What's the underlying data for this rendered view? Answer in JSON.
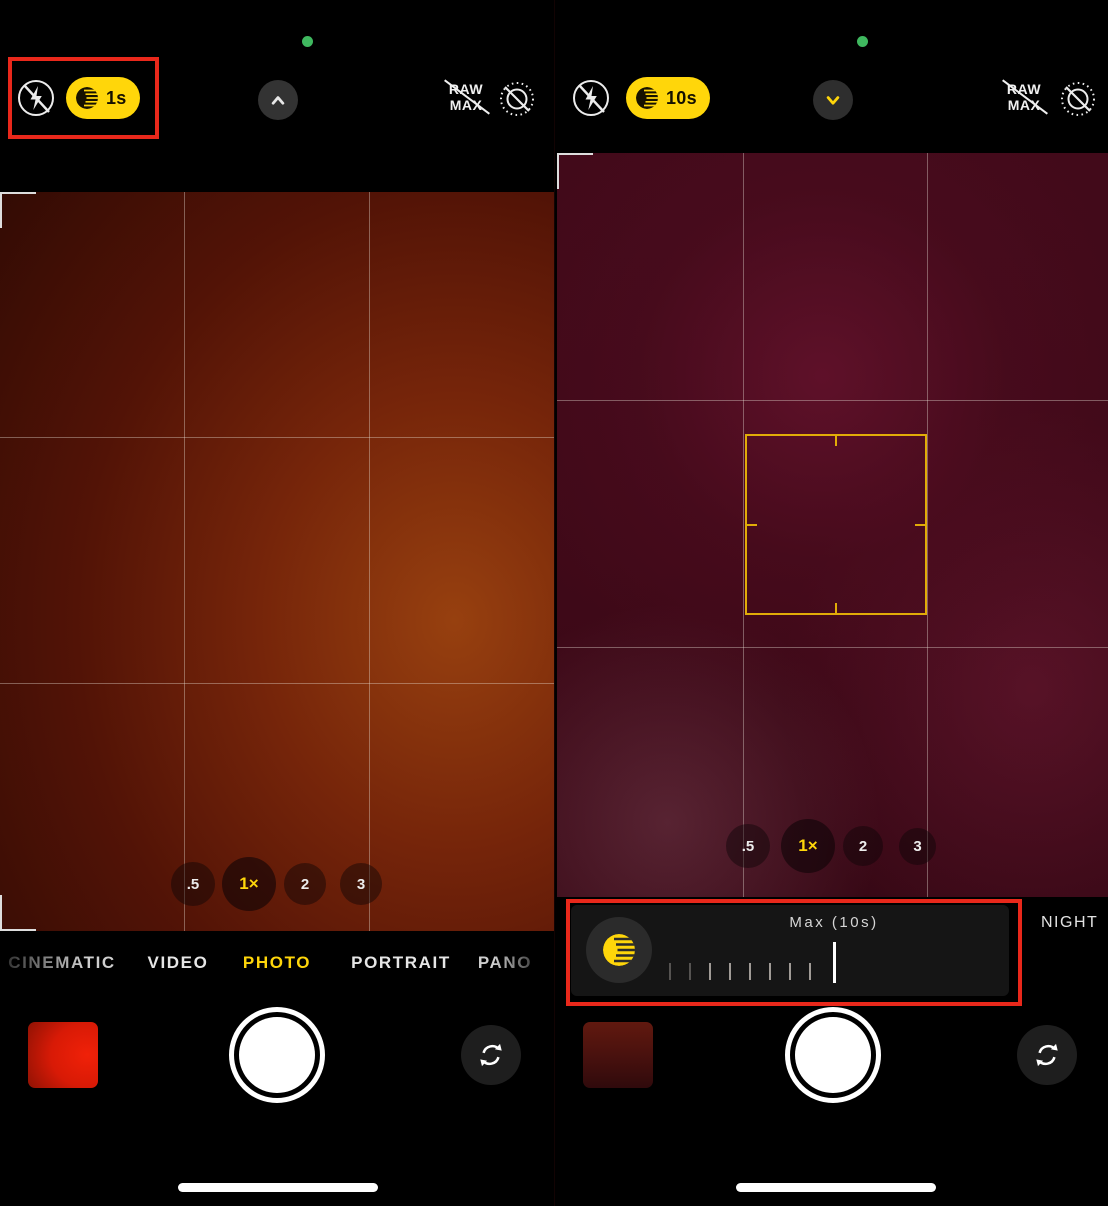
{
  "colors": {
    "accent_yellow": "#FFD60A",
    "highlight_red": "#E9281B",
    "status_green": "#3FB85F",
    "focus_yellow": "#E1AC08"
  },
  "left": {
    "night_badge": "1s",
    "raw": {
      "line1": "RAW",
      "line2": "MAX"
    },
    "zoom": [
      ".5",
      "1×",
      "2",
      "3"
    ],
    "active_zoom": "1×",
    "modes": [
      "CINEMATIC",
      "VIDEO",
      "PHOTO",
      "PORTRAIT",
      "PANO"
    ],
    "active_mode": "PHOTO"
  },
  "right": {
    "night_badge": "10s",
    "raw": {
      "line1": "RAW",
      "line2": "MAX"
    },
    "zoom": [
      ".5",
      "1×",
      "2",
      "3"
    ],
    "active_zoom": "1×",
    "slider": {
      "value_label": "Max (10s)",
      "mode_label": "NIGHT"
    }
  },
  "icons": {
    "flash_off": "flash-off-icon",
    "night_mode": "night-mode-moon-icon",
    "chevron_up": "chevron-up-icon",
    "chevron_down": "chevron-down-icon",
    "live_photo_off": "live-photo-off-icon",
    "macro": "macro-flower-icon",
    "flip_camera": "flip-camera-icon"
  }
}
